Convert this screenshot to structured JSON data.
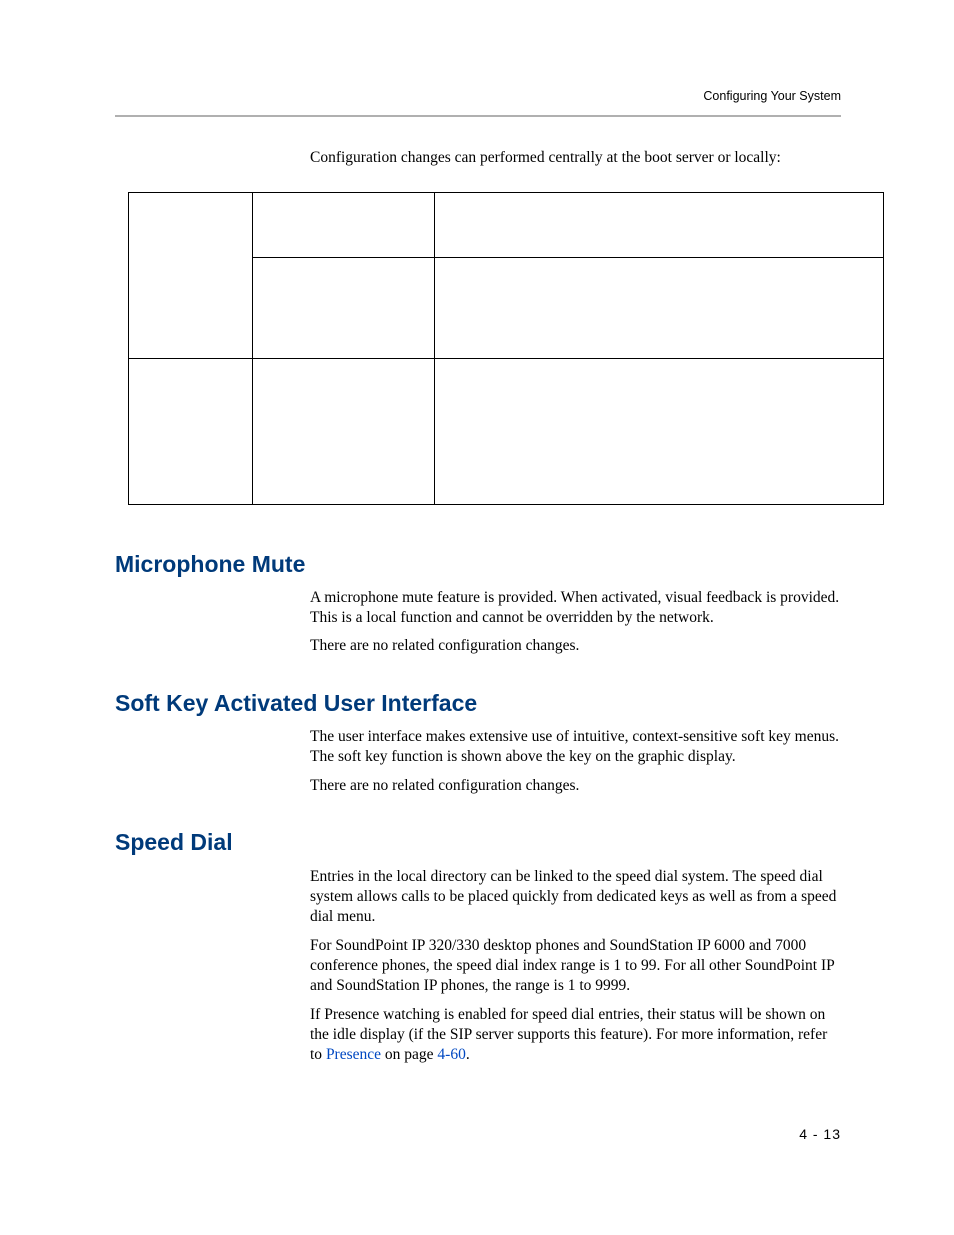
{
  "header": {
    "running": "Configuring Your System"
  },
  "intro": "Configuration changes can performed centrally at the boot server or locally:",
  "table": {
    "r1c1": "",
    "r1c2": "",
    "r1c3": "",
    "r2c2": "",
    "r2c3": "",
    "r3c1": "",
    "r3c2": "",
    "r3c3": ""
  },
  "sections": {
    "mic": {
      "title": "Microphone Mute",
      "p1": "A microphone mute feature is provided. When activated, visual feedback is provided. This is a local function and cannot be overridden by the network.",
      "p2": "There are no related configuration changes."
    },
    "softkey": {
      "title": "Soft Key Activated User Interface",
      "p1": "The user interface makes extensive use of intuitive, context-sensitive soft key menus. The soft key function is shown above the key on the graphic display.",
      "p2": "There are no related configuration changes."
    },
    "speed": {
      "title": "Speed Dial",
      "p1": "Entries in the local directory can be linked to the speed dial system. The speed dial system allows calls to be placed quickly from dedicated keys as well as from a speed dial menu.",
      "p2": "For SoundPoint IP 320/330 desktop phones and SoundStation IP 6000 and 7000 conference phones, the speed dial index range is 1 to 99. For all other SoundPoint IP and SoundStation IP phones, the range is 1 to 9999.",
      "p3_pre": "If Presence watching is enabled for speed dial entries, their status will be shown on the idle display (if the SIP server supports this feature). For more information, refer to ",
      "p3_link": "Presence",
      "p3_mid": " on page ",
      "p3_page": "4-60",
      "p3_post": "."
    }
  },
  "folio": "4 - 13"
}
